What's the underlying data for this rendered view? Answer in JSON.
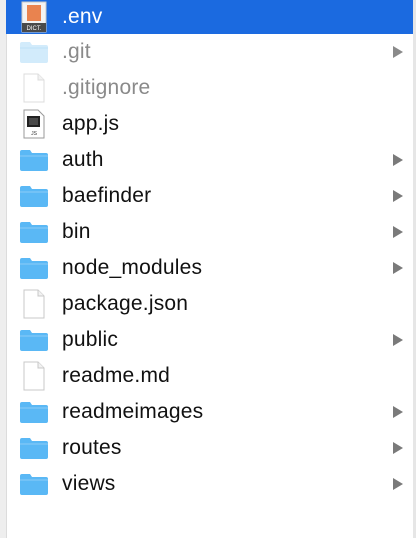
{
  "colors": {
    "selection": "#1b6ae0",
    "folder": "#5ab8f5",
    "folder_hidden": "#d2ebfb"
  },
  "items": [
    {
      "label": ".env",
      "icon": "dict-file-icon",
      "selected": true,
      "hidden": false,
      "folder": false
    },
    {
      "label": ".git",
      "icon": "folder-icon",
      "selected": false,
      "hidden": true,
      "folder": true
    },
    {
      "label": ".gitignore",
      "icon": "document-icon",
      "selected": false,
      "hidden": true,
      "folder": false
    },
    {
      "label": "app.js",
      "icon": "js-file-icon",
      "selected": false,
      "hidden": false,
      "folder": false
    },
    {
      "label": "auth",
      "icon": "folder-icon",
      "selected": false,
      "hidden": false,
      "folder": true
    },
    {
      "label": "baefinder",
      "icon": "folder-icon",
      "selected": false,
      "hidden": false,
      "folder": true
    },
    {
      "label": "bin",
      "icon": "folder-icon",
      "selected": false,
      "hidden": false,
      "folder": true
    },
    {
      "label": "node_modules",
      "icon": "folder-icon",
      "selected": false,
      "hidden": false,
      "folder": true
    },
    {
      "label": "package.json",
      "icon": "document-icon",
      "selected": false,
      "hidden": false,
      "folder": false
    },
    {
      "label": "public",
      "icon": "folder-icon",
      "selected": false,
      "hidden": false,
      "folder": true
    },
    {
      "label": "readme.md",
      "icon": "document-icon",
      "selected": false,
      "hidden": false,
      "folder": false
    },
    {
      "label": "readmeimages",
      "icon": "folder-icon",
      "selected": false,
      "hidden": false,
      "folder": true
    },
    {
      "label": "routes",
      "icon": "folder-icon",
      "selected": false,
      "hidden": false,
      "folder": true
    },
    {
      "label": "views",
      "icon": "folder-icon",
      "selected": false,
      "hidden": false,
      "folder": true
    }
  ],
  "dict_icon_caption": "DICT."
}
